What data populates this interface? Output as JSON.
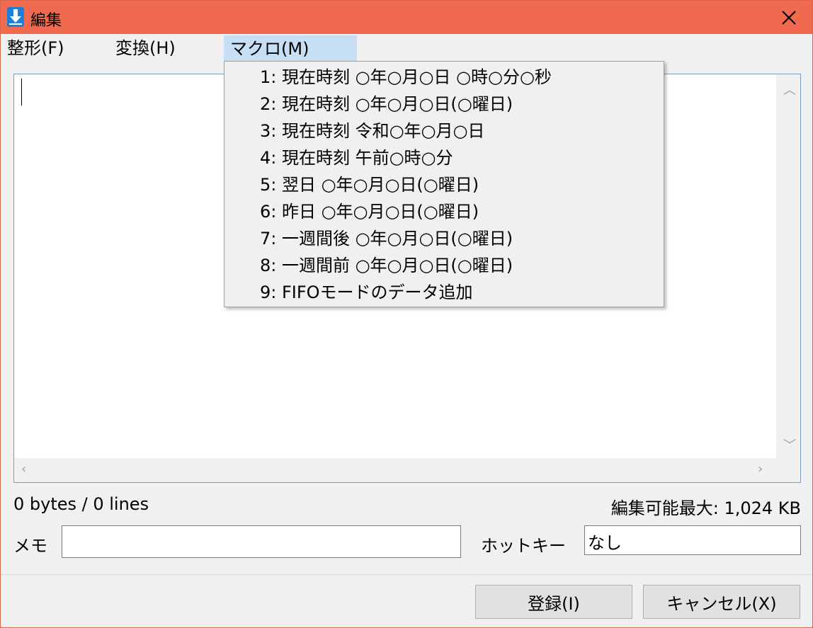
{
  "window": {
    "title": "編集"
  },
  "menubar": {
    "items": [
      {
        "label": "整形(F)"
      },
      {
        "label": "変換(H)"
      },
      {
        "label": "マクロ(M)"
      }
    ]
  },
  "macro_menu": {
    "items": [
      {
        "label": "1: 現在時刻 ○年○月○日 ○時○分○秒"
      },
      {
        "label": "2: 現在時刻 ○年○月○日(○曜日)"
      },
      {
        "label": "3: 現在時刻 令和○年○月○日"
      },
      {
        "label": "4: 現在時刻 午前○時○分"
      },
      {
        "label": "5: 翌日 ○年○月○日(○曜日)"
      },
      {
        "label": "6: 昨日 ○年○月○日(○曜日)"
      },
      {
        "label": "7: 一週間後 ○年○月○日(○曜日)"
      },
      {
        "label": "8: 一週間前 ○年○月○日(○曜日)"
      },
      {
        "label": "9: FIFOモードのデータ追加"
      }
    ]
  },
  "editor": {
    "content": ""
  },
  "status": {
    "size": "0 bytes / 0 lines",
    "max": "編集可能最大: 1,024 KB"
  },
  "fields": {
    "memo_label": "メモ",
    "memo_value": "",
    "hotkey_label": "ホットキー",
    "hotkey_value": "なし"
  },
  "buttons": {
    "register": "登録(I)",
    "cancel": "キャンセル(X)"
  },
  "colors": {
    "titlebar": "#f06a50",
    "menu_highlight": "#c7dff5",
    "app_icon": "#1d7fd6"
  }
}
